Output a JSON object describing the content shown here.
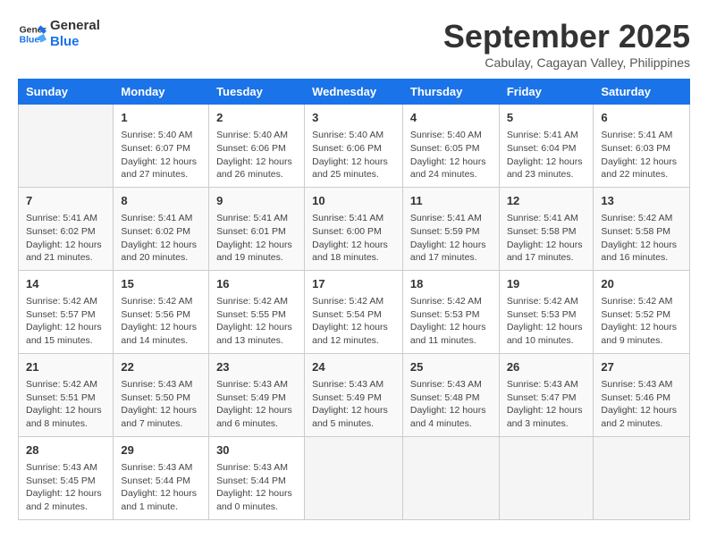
{
  "header": {
    "logo_line1": "General",
    "logo_line2": "Blue",
    "month": "September 2025",
    "location": "Cabulay, Cagayan Valley, Philippines"
  },
  "columns": [
    "Sunday",
    "Monday",
    "Tuesday",
    "Wednesday",
    "Thursday",
    "Friday",
    "Saturday"
  ],
  "weeks": [
    [
      {
        "day": "",
        "info": ""
      },
      {
        "day": "1",
        "info": "Sunrise: 5:40 AM\nSunset: 6:07 PM\nDaylight: 12 hours\nand 27 minutes."
      },
      {
        "day": "2",
        "info": "Sunrise: 5:40 AM\nSunset: 6:06 PM\nDaylight: 12 hours\nand 26 minutes."
      },
      {
        "day": "3",
        "info": "Sunrise: 5:40 AM\nSunset: 6:06 PM\nDaylight: 12 hours\nand 25 minutes."
      },
      {
        "day": "4",
        "info": "Sunrise: 5:40 AM\nSunset: 6:05 PM\nDaylight: 12 hours\nand 24 minutes."
      },
      {
        "day": "5",
        "info": "Sunrise: 5:41 AM\nSunset: 6:04 PM\nDaylight: 12 hours\nand 23 minutes."
      },
      {
        "day": "6",
        "info": "Sunrise: 5:41 AM\nSunset: 6:03 PM\nDaylight: 12 hours\nand 22 minutes."
      }
    ],
    [
      {
        "day": "7",
        "info": "Sunrise: 5:41 AM\nSunset: 6:02 PM\nDaylight: 12 hours\nand 21 minutes."
      },
      {
        "day": "8",
        "info": "Sunrise: 5:41 AM\nSunset: 6:02 PM\nDaylight: 12 hours\nand 20 minutes."
      },
      {
        "day": "9",
        "info": "Sunrise: 5:41 AM\nSunset: 6:01 PM\nDaylight: 12 hours\nand 19 minutes."
      },
      {
        "day": "10",
        "info": "Sunrise: 5:41 AM\nSunset: 6:00 PM\nDaylight: 12 hours\nand 18 minutes."
      },
      {
        "day": "11",
        "info": "Sunrise: 5:41 AM\nSunset: 5:59 PM\nDaylight: 12 hours\nand 17 minutes."
      },
      {
        "day": "12",
        "info": "Sunrise: 5:41 AM\nSunset: 5:58 PM\nDaylight: 12 hours\nand 17 minutes."
      },
      {
        "day": "13",
        "info": "Sunrise: 5:42 AM\nSunset: 5:58 PM\nDaylight: 12 hours\nand 16 minutes."
      }
    ],
    [
      {
        "day": "14",
        "info": "Sunrise: 5:42 AM\nSunset: 5:57 PM\nDaylight: 12 hours\nand 15 minutes."
      },
      {
        "day": "15",
        "info": "Sunrise: 5:42 AM\nSunset: 5:56 PM\nDaylight: 12 hours\nand 14 minutes."
      },
      {
        "day": "16",
        "info": "Sunrise: 5:42 AM\nSunset: 5:55 PM\nDaylight: 12 hours\nand 13 minutes."
      },
      {
        "day": "17",
        "info": "Sunrise: 5:42 AM\nSunset: 5:54 PM\nDaylight: 12 hours\nand 12 minutes."
      },
      {
        "day": "18",
        "info": "Sunrise: 5:42 AM\nSunset: 5:53 PM\nDaylight: 12 hours\nand 11 minutes."
      },
      {
        "day": "19",
        "info": "Sunrise: 5:42 AM\nSunset: 5:53 PM\nDaylight: 12 hours\nand 10 minutes."
      },
      {
        "day": "20",
        "info": "Sunrise: 5:42 AM\nSunset: 5:52 PM\nDaylight: 12 hours\nand 9 minutes."
      }
    ],
    [
      {
        "day": "21",
        "info": "Sunrise: 5:42 AM\nSunset: 5:51 PM\nDaylight: 12 hours\nand 8 minutes."
      },
      {
        "day": "22",
        "info": "Sunrise: 5:43 AM\nSunset: 5:50 PM\nDaylight: 12 hours\nand 7 minutes."
      },
      {
        "day": "23",
        "info": "Sunrise: 5:43 AM\nSunset: 5:49 PM\nDaylight: 12 hours\nand 6 minutes."
      },
      {
        "day": "24",
        "info": "Sunrise: 5:43 AM\nSunset: 5:49 PM\nDaylight: 12 hours\nand 5 minutes."
      },
      {
        "day": "25",
        "info": "Sunrise: 5:43 AM\nSunset: 5:48 PM\nDaylight: 12 hours\nand 4 minutes."
      },
      {
        "day": "26",
        "info": "Sunrise: 5:43 AM\nSunset: 5:47 PM\nDaylight: 12 hours\nand 3 minutes."
      },
      {
        "day": "27",
        "info": "Sunrise: 5:43 AM\nSunset: 5:46 PM\nDaylight: 12 hours\nand 2 minutes."
      }
    ],
    [
      {
        "day": "28",
        "info": "Sunrise: 5:43 AM\nSunset: 5:45 PM\nDaylight: 12 hours\nand 2 minutes."
      },
      {
        "day": "29",
        "info": "Sunrise: 5:43 AM\nSunset: 5:44 PM\nDaylight: 12 hours\nand 1 minute."
      },
      {
        "day": "30",
        "info": "Sunrise: 5:43 AM\nSunset: 5:44 PM\nDaylight: 12 hours\nand 0 minutes."
      },
      {
        "day": "",
        "info": ""
      },
      {
        "day": "",
        "info": ""
      },
      {
        "day": "",
        "info": ""
      },
      {
        "day": "",
        "info": ""
      }
    ]
  ]
}
